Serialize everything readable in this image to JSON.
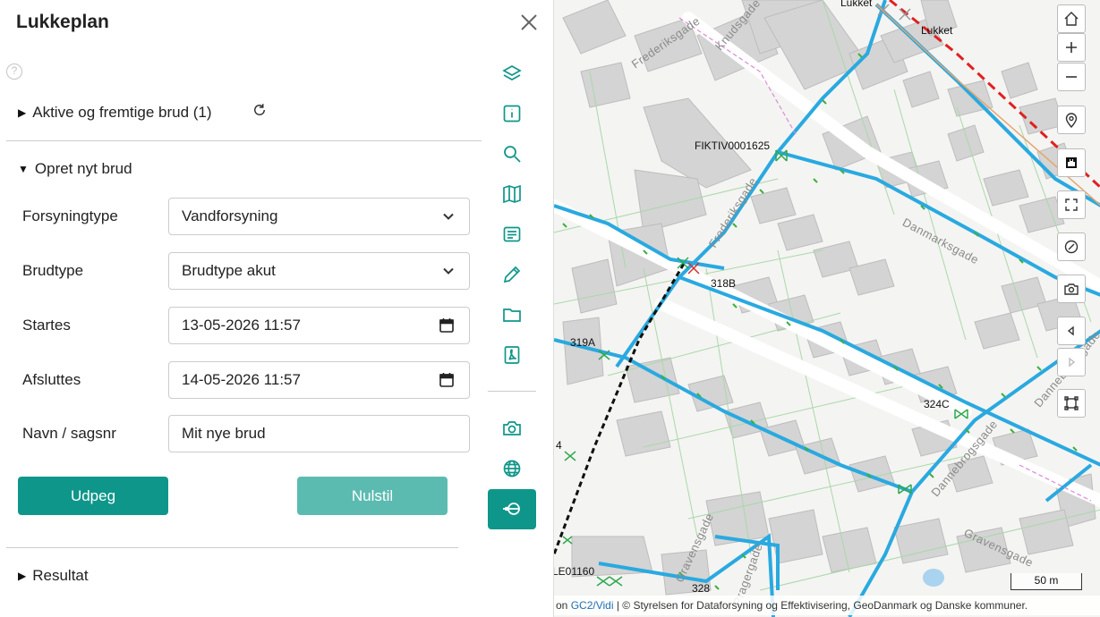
{
  "panel": {
    "title": "Lukkeplan",
    "help_icon": "question-circle-icon",
    "section_active": {
      "label": "Aktive og fremtige brud (1)",
      "refresh_icon": "refresh-icon"
    },
    "section_create": {
      "label": "Opret nyt brud",
      "fields": [
        {
          "label": "Forsyningtype",
          "value": "Vandforsyning",
          "kind": "select"
        },
        {
          "label": "Brudtype",
          "value": "Brudtype akut",
          "kind": "select"
        },
        {
          "label": "Startes",
          "value": "13-05-2026 11:57",
          "kind": "datetime"
        },
        {
          "label": "Afsluttes",
          "value": "14-05-2026 11:57",
          "kind": "datetime"
        },
        {
          "label": "Navn / sagsnr",
          "value": "Mit nye brud",
          "kind": "text"
        }
      ],
      "primary_button": "Udpeg",
      "reset_button": "Nulstil"
    },
    "section_result": {
      "label": "Resultat"
    }
  },
  "tools": {
    "close_icon": "close-icon",
    "items": [
      "layers-icon",
      "info-icon",
      "search-icon",
      "map-icon",
      "legend-icon",
      "pencil-icon",
      "folder-icon",
      "pdf-icon"
    ],
    "extra": [
      "camera-icon",
      "globe-icon"
    ],
    "active": "valve-icon",
    "accent": "#0f968a"
  },
  "map": {
    "labels": {
      "lukket_top": "Lukket",
      "lukket": "Lukket",
      "fiktiv": "FIKTIV0001625",
      "l318b": "318B",
      "l319a": "319A",
      "l324c": "324C",
      "l328": "328",
      "le01160": "LE01160",
      "l4": "4"
    },
    "streets": {
      "frederiksgade_top": "Frederiksgade",
      "knudsgade": "Knudsgade",
      "frederiksgade": "Frederiksgade",
      "danmarksgade": "Danmarksgade",
      "danneborgsgade": "Danneborgsgade",
      "dannebrogsgade": "Dannebrogsgade",
      "gravensgade": "Gravensgade",
      "gravensgade2": "Gravensgade",
      "pragergade": "Pragergade"
    },
    "controls": [
      "home-icon",
      "zoom-in-icon",
      "zoom-out-icon",
      "location-icon",
      "ruler-icon",
      "fullscreen-icon",
      "compass-icon",
      "screenshot-icon",
      "back-icon",
      "forward-icon",
      "extent-icon"
    ],
    "scale": "50 m",
    "attribution": {
      "prefix": "on ",
      "link": "GC2/Vidi",
      "rest": " | © Styrelsen for Dataforsyning og Effektivisering, GeoDanmark og Danske kommuner."
    },
    "pipe_color": "#29a9e0"
  }
}
